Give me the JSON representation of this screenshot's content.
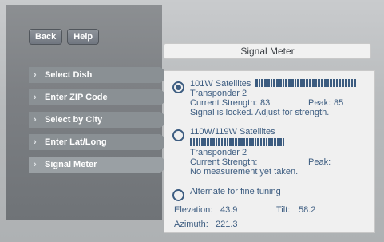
{
  "ui": {
    "buttons": {
      "back": "Back",
      "help": "Help"
    },
    "menu": [
      {
        "label": "Select Dish"
      },
      {
        "label": "Enter ZIP Code"
      },
      {
        "label": "Select by City"
      },
      {
        "label": "Enter Lat/Long"
      },
      {
        "label": "Signal Meter"
      }
    ],
    "signal_meter": {
      "title": "Signal Meter",
      "option1_label": "101W Satellites",
      "option1_progress": 1.0,
      "transponder1": "Transponder 2",
      "current_strength_label": "Current Strength:",
      "current_strength1": "83",
      "peak_label": "Peak:",
      "peak1": "85",
      "status1": "Signal is locked. Adjust for strength.",
      "option2_label": "110W/119W Satellites",
      "option2_progress": 1.0,
      "transponder2": "Transponder 2",
      "current_strength2": "",
      "peak2": "",
      "status2": "No measurement yet taken.",
      "option3_label": "Alternate for fine tuning",
      "elevation_label": "Elevation:",
      "elevation_value": "43.9",
      "tilt_label": "Tilt:",
      "tilt_value": "58.2",
      "azimuth_label": "Azimuth:",
      "azimuth_value": "221.3"
    },
    "colors": {
      "accent": "#3c5c80",
      "panel_bg": "#f0f0f0",
      "left_panel": "#7d8084",
      "menu_item": "#8a9094"
    }
  }
}
